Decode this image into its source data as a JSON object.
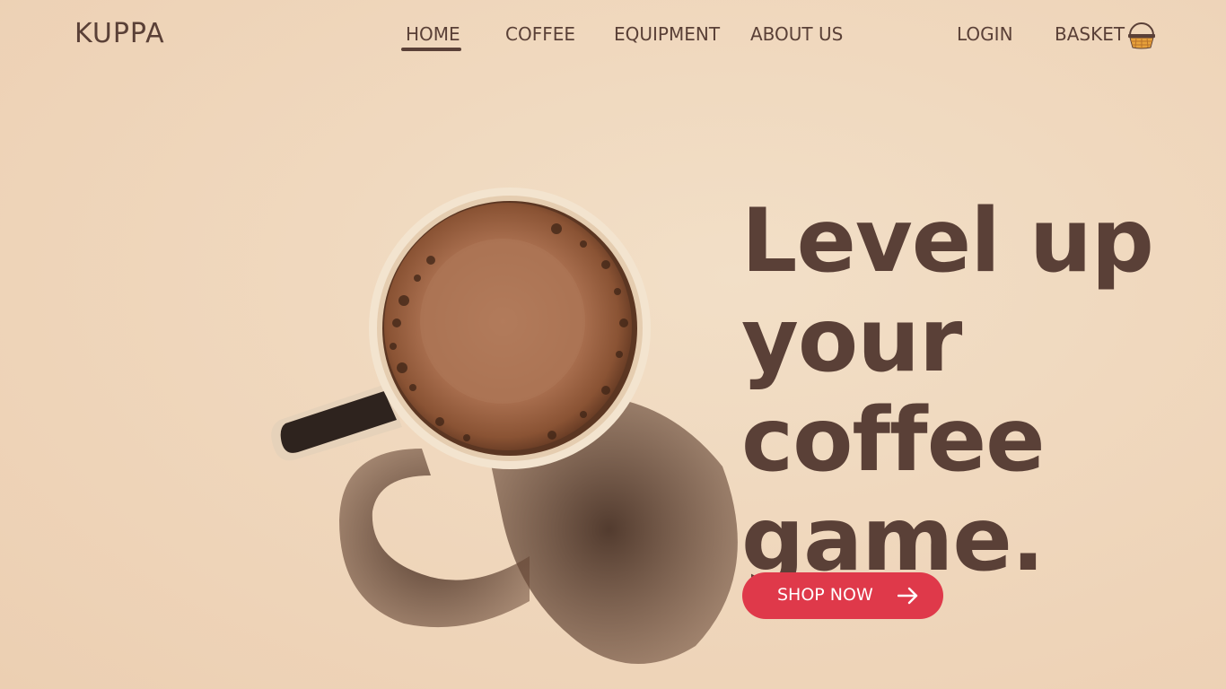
{
  "brand": {
    "logo_text": "KUPPA"
  },
  "nav": {
    "links": [
      {
        "label": "HOME",
        "active": true
      },
      {
        "label": "COFFEE",
        "active": false
      },
      {
        "label": "EQUIPMENT",
        "active": false
      },
      {
        "label": "ABOUT US",
        "active": false
      }
    ],
    "login_label": "LOGIN",
    "basket_label": "BASKET",
    "basket_icon": "basket-icon"
  },
  "hero": {
    "headline_lines": [
      "Level up",
      "your",
      "coffee",
      "game."
    ],
    "cta_label": "SHOP NOW",
    "cta_icon": "arrow-right-icon",
    "image": "coffee-mug-top-view"
  },
  "colors": {
    "background": "#efd6bb",
    "text": "#5a4037",
    "accent": "#df394a"
  }
}
